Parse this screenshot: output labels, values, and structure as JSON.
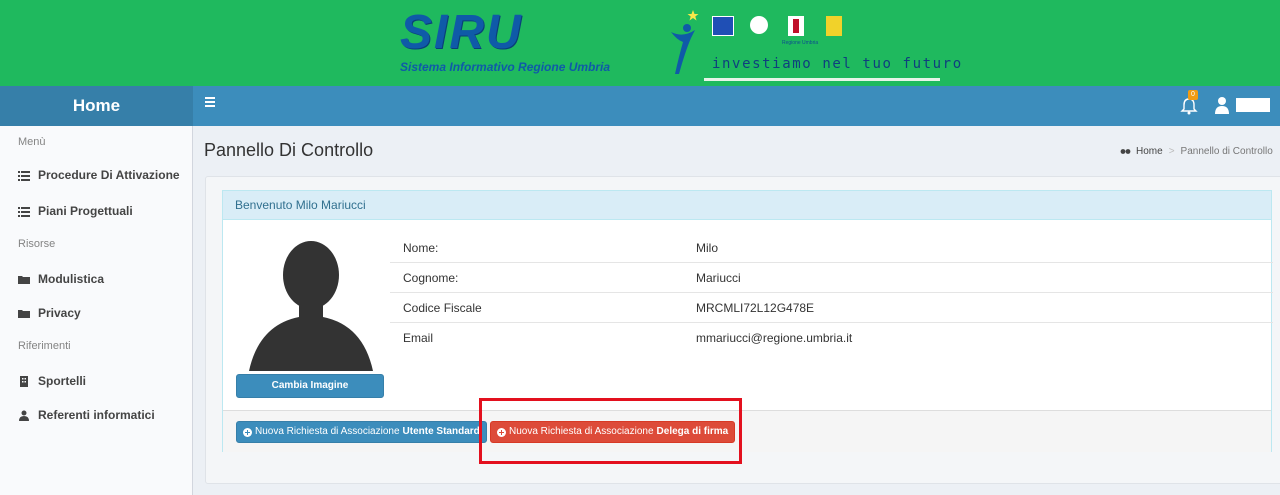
{
  "banner": {
    "logo_title": "SIRU",
    "logo_subtitle": "Sistema Informativo Regione Umbria",
    "slogan": "investiamo nel tuo futuro",
    "flag_label": "Regione Umbria"
  },
  "navbar": {
    "home_label": "Home",
    "notification_count": "0",
    "user_name": "████"
  },
  "sidebar": {
    "sections": [
      {
        "header": "Menù",
        "items": [
          {
            "label": "Procedure Di Attivazione",
            "icon": "list-icon"
          },
          {
            "label": "Piani Progettuali",
            "icon": "list-icon"
          }
        ]
      },
      {
        "header": "Risorse",
        "items": [
          {
            "label": "Modulistica",
            "icon": "folder-icon"
          },
          {
            "label": "Privacy",
            "icon": "folder-icon"
          }
        ]
      },
      {
        "header": "Riferimenti",
        "items": [
          {
            "label": "Sportelli",
            "icon": "building-icon"
          },
          {
            "label": "Referenti informatici",
            "icon": "user-icon"
          }
        ]
      }
    ]
  },
  "content": {
    "title": "Pannello Di Controllo",
    "breadcrumb": {
      "home": "Home",
      "current": "Pannello di Controllo"
    },
    "panel": {
      "heading": "Benvenuto Milo Mariucci",
      "change_image_label": "Cambia Imagine",
      "fields": [
        {
          "label": "Nome:",
          "value": "Milo"
        },
        {
          "label": "Cognome:",
          "value": "Mariucci"
        },
        {
          "label": "Codice Fiscale",
          "value": "MRCMLI72L12G478E"
        },
        {
          "label": "Email",
          "value": "mmariucci@regione.umbria.it"
        }
      ],
      "btn_standard_prefix": "Nuova Richiesta di Associazione",
      "btn_standard_bold": "Utente Standard",
      "btn_delega_prefix": "Nuova Richiesta di Associazione",
      "btn_delega_bold": "Delega di firma"
    }
  },
  "colors": {
    "banner_green": "#1fb95e",
    "navbar_blue": "#3c8dbc",
    "danger_red": "#dd4b39",
    "highlight_red": "#e3101e"
  }
}
